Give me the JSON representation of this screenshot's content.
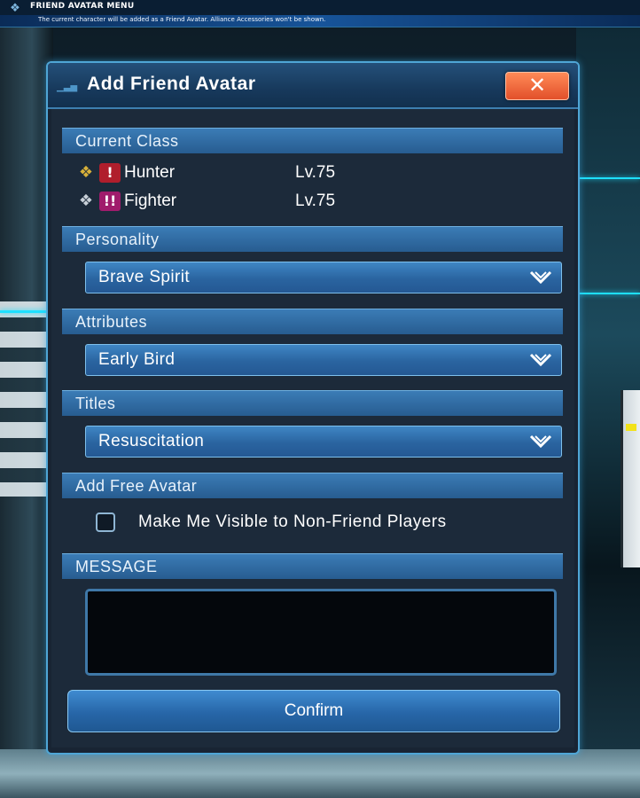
{
  "top_bar": {
    "title": "FRIEND AVATAR MENU",
    "info": "The current character will be added as a Friend Avatar. Alliance Accessories won't be shown."
  },
  "dialog": {
    "title": "Add Friend Avatar",
    "close_label": "✕",
    "sections": {
      "current_class": "Current Class",
      "personality": "Personality",
      "attributes": "Attributes",
      "titles": "Titles",
      "add_free_avatar": "Add Free Avatar",
      "message": "MESSAGE"
    },
    "classes": [
      {
        "emblem": "main-class-icon",
        "badge": "!",
        "badge_color": "#b01e2c",
        "name": "Hunter",
        "level": "Lv.75"
      },
      {
        "emblem": "sub-class-icon",
        "badge": "!!",
        "badge_color": "#a01c6c",
        "name": "Fighter",
        "level": "Lv.75"
      }
    ],
    "personality_value": "Brave Spirit",
    "attributes_value": "Early Bird",
    "titles_value": "Resuscitation",
    "checkbox_label": "Make Me Visible to Non-Friend Players",
    "checkbox_checked": false,
    "message_value": "",
    "confirm_label": "Confirm"
  },
  "colors": {
    "accent": "#3b7cb6",
    "close": "#e2502a",
    "highlight": "#1ee0ff"
  }
}
